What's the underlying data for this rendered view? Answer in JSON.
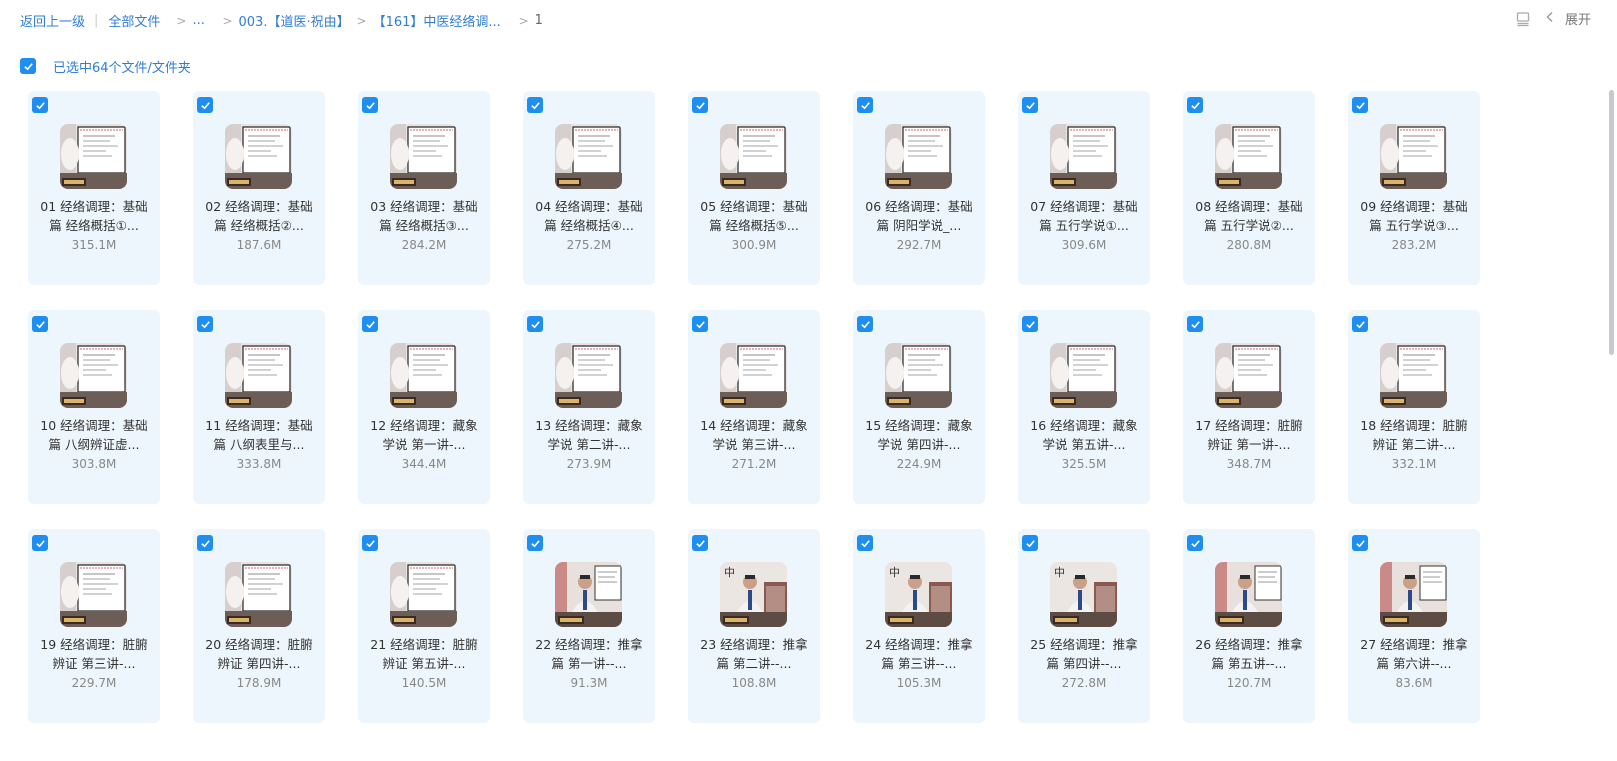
{
  "breadcrumb": {
    "back_label": "返回上一级",
    "all_files": "全部文件",
    "ellipsis": "...",
    "folder_1": "003.【道医·祝由】",
    "folder_2": "【161】中医经络调...",
    "current": "1"
  },
  "toolbar": {
    "expand_label": "展开"
  },
  "selection": {
    "label": "已选中64个文件/文件夹"
  },
  "colors": {
    "accent": "#1f8ef1",
    "link": "#2f7dd8",
    "card_bg": "#eef6fd"
  },
  "files": [
    {
      "name": "01 经络调理：基础篇 经络概括①...",
      "size": "315.1M",
      "thumb": "lecture-slide"
    },
    {
      "name": "02 经络调理：基础篇 经络概括②...",
      "size": "187.6M",
      "thumb": "lecture-slide"
    },
    {
      "name": "03 经络调理：基础篇 经络概括③...",
      "size": "284.2M",
      "thumb": "lecture-slide"
    },
    {
      "name": "04 经络调理：基础篇 经络概括④...",
      "size": "275.2M",
      "thumb": "lecture-slide"
    },
    {
      "name": "05 经络调理：基础篇 经络概括⑤...",
      "size": "300.9M",
      "thumb": "lecture-slide"
    },
    {
      "name": "06 经络调理：基础篇 阴阳学说_...",
      "size": "292.7M",
      "thumb": "lecture-slide"
    },
    {
      "name": "07 经络调理：基础篇 五行学说①...",
      "size": "309.6M",
      "thumb": "lecture-slide"
    },
    {
      "name": "08 经络调理：基础篇 五行学说②...",
      "size": "280.8M",
      "thumb": "lecture-slide"
    },
    {
      "name": "09 经络调理：基础篇 五行学说③...",
      "size": "283.2M",
      "thumb": "lecture-slide"
    },
    {
      "name": "10 经络调理：基础篇 八纲辨证虚...",
      "size": "303.8M",
      "thumb": "lecture-slide"
    },
    {
      "name": "11 经络调理：基础篇 八纲表里与...",
      "size": "333.8M",
      "thumb": "lecture-slide"
    },
    {
      "name": "12 经络调理：藏象学说 第一讲-...",
      "size": "344.4M",
      "thumb": "lecture-slide"
    },
    {
      "name": "13 经络调理：藏象学说 第二讲-...",
      "size": "273.9M",
      "thumb": "lecture-slide"
    },
    {
      "name": "14 经络调理：藏象学说 第三讲-...",
      "size": "271.2M",
      "thumb": "lecture-slide"
    },
    {
      "name": "15 经络调理：藏象学说 第四讲-...",
      "size": "224.9M",
      "thumb": "lecture-slide"
    },
    {
      "name": "16 经络调理：藏象学说 第五讲-...",
      "size": "325.5M",
      "thumb": "lecture-slide"
    },
    {
      "name": "17 经络调理：脏腑辨证 第一讲-...",
      "size": "348.7M",
      "thumb": "lecture-slide"
    },
    {
      "name": "18 经络调理：脏腑辨证 第二讲-...",
      "size": "332.1M",
      "thumb": "lecture-slide"
    },
    {
      "name": "19 经络调理：脏腑辨证 第三讲-...",
      "size": "229.7M",
      "thumb": "lecture-slide"
    },
    {
      "name": "20 经络调理：脏腑辨证 第四讲-...",
      "size": "178.9M",
      "thumb": "lecture-slide"
    },
    {
      "name": "21 经络调理：脏腑辨证 第五讲-...",
      "size": "140.5M",
      "thumb": "lecture-slide"
    },
    {
      "name": "22 经络调理：推拿篇 第一讲--...",
      "size": "91.3M",
      "thumb": "lecture-speaker"
    },
    {
      "name": "23 经络调理：推拿篇 第二讲--...",
      "size": "108.8M",
      "thumb": "lecture-speaker-banner"
    },
    {
      "name": "24 经络调理：推拿篇 第三讲--...",
      "size": "105.3M",
      "thumb": "lecture-speaker-banner"
    },
    {
      "name": "25 经络调理：推拿篇 第四讲--...",
      "size": "272.8M",
      "thumb": "lecture-speaker-banner"
    },
    {
      "name": "26 经络调理：推拿篇 第五讲--...",
      "size": "120.7M",
      "thumb": "lecture-speaker"
    },
    {
      "name": "27 经络调理：推拿篇 第六讲--...",
      "size": "83.6M",
      "thumb": "lecture-speaker"
    }
  ]
}
